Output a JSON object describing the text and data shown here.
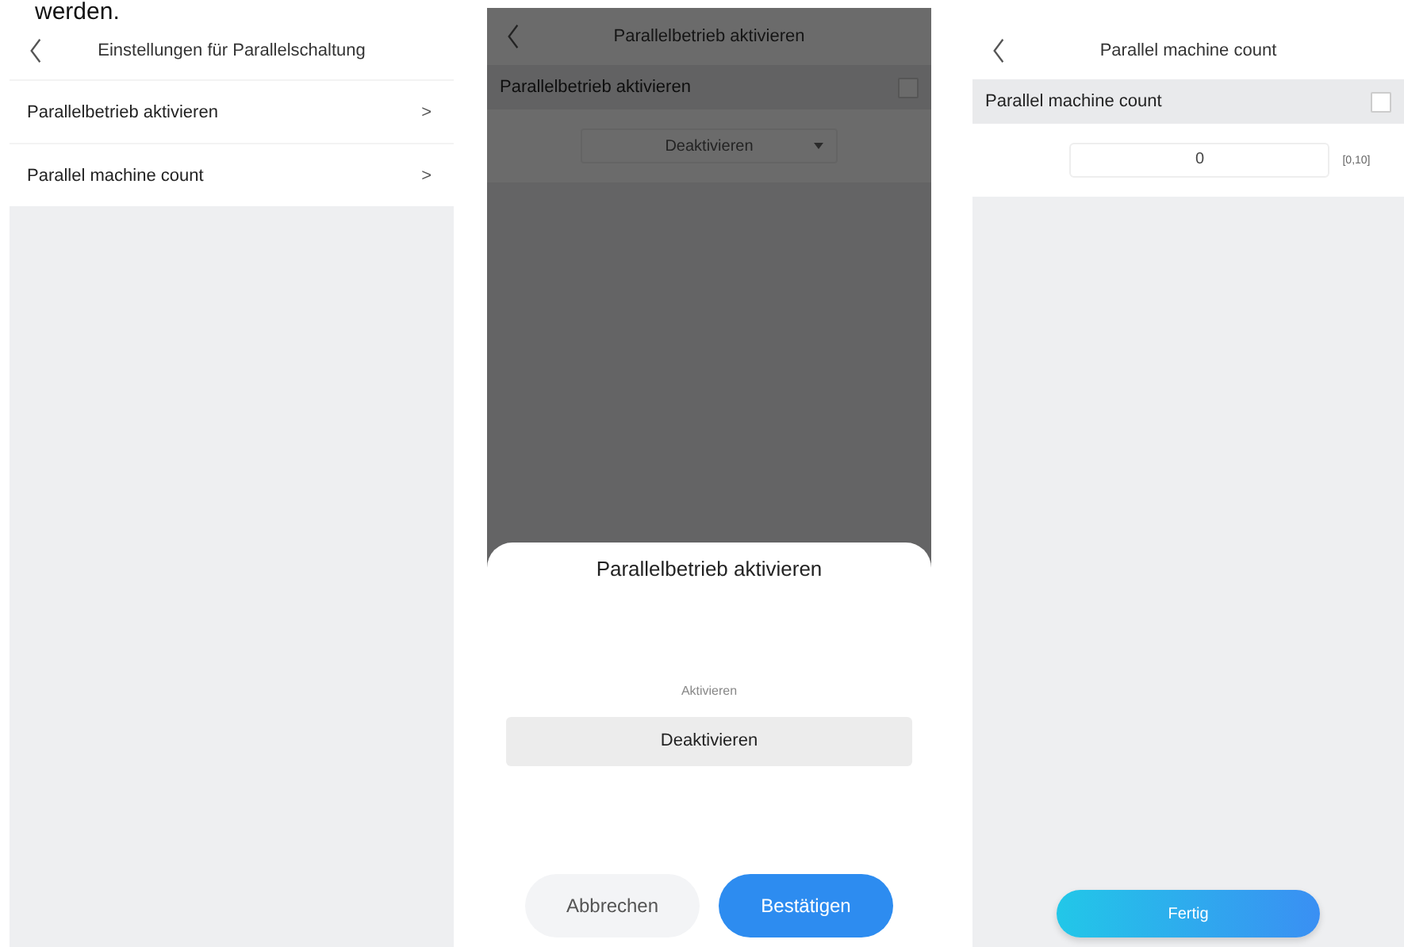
{
  "caption": "werden.",
  "screens": [
    {
      "kind": "menu",
      "title": "Einstellungen für Parallelschaltung",
      "items": [
        {
          "label": "Parallelbetrieb aktivieren",
          "chevron": ">"
        },
        {
          "label": "Parallel machine count",
          "chevron": ">"
        }
      ]
    },
    {
      "kind": "select",
      "title": "Parallelbetrieb aktivieren",
      "field_label": "Parallelbetrieb aktivieren",
      "checked": false,
      "value": "Deaktivieren",
      "sheet": {
        "title": "Parallelbetrieb aktivieren",
        "options": [
          {
            "label": "Aktivieren",
            "selected": false
          },
          {
            "label": "Deaktivieren",
            "selected": true
          }
        ],
        "buttons": [
          {
            "label": "Abbrechen",
            "kind": "secondary"
          },
          {
            "label": "Bestätigen",
            "kind": "primary"
          }
        ]
      }
    },
    {
      "kind": "number",
      "title": "Parallel machine count",
      "field_label": "Parallel machine count",
      "checked": false,
      "value": "0",
      "range": "[0,10]",
      "button": "Fertig"
    }
  ]
}
